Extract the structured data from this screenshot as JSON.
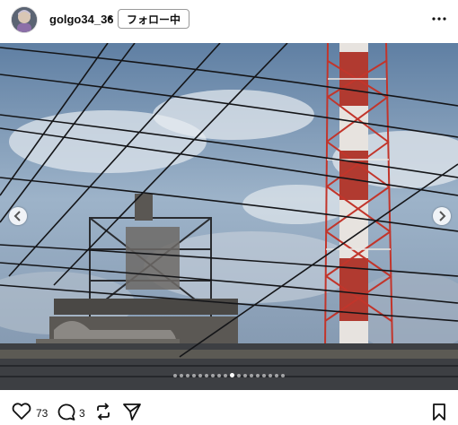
{
  "header": {
    "username": "golgo34_36",
    "separator": "•",
    "follow_label": "フォロー中"
  },
  "icons": {
    "avatar": "avatar",
    "more": "more-horizontal-icon",
    "prev": "chevron-left-icon",
    "next": "chevron-right-icon",
    "like": "heart-icon",
    "comment": "comment-icon",
    "repost": "repost-icon",
    "share": "send-icon",
    "save": "bookmark-icon"
  },
  "carousel": {
    "total": 18,
    "active_index": 9
  },
  "actions": {
    "like_count": "73",
    "comment_count": "3"
  }
}
